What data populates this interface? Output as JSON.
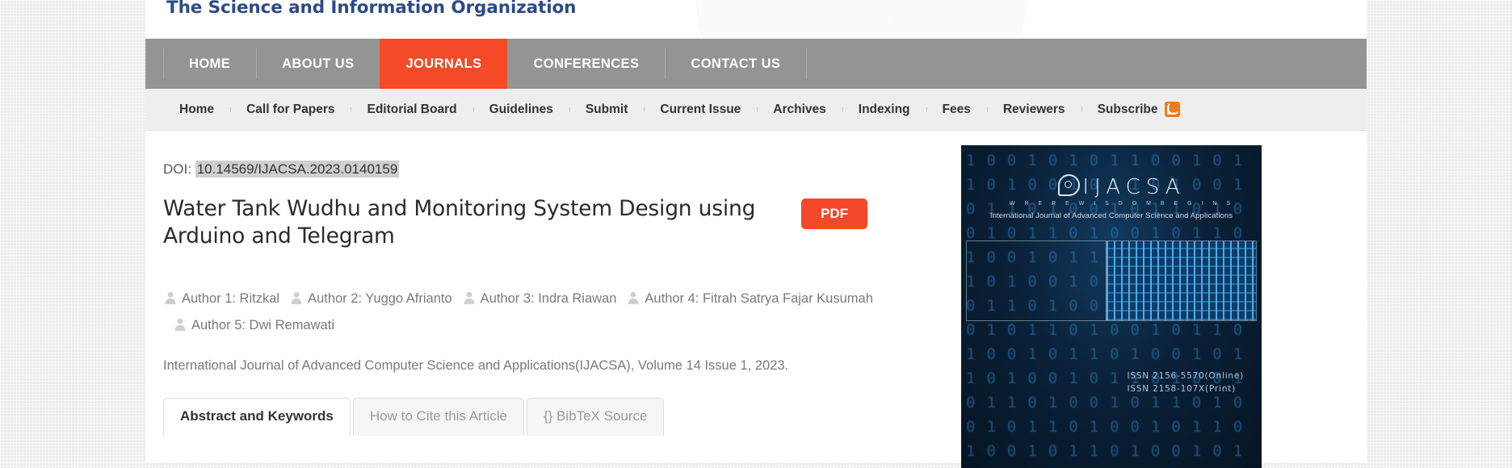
{
  "site": {
    "org_name": "The Science and Information Organization"
  },
  "main_nav": {
    "items": [
      {
        "label": "HOME",
        "active": false
      },
      {
        "label": "ABOUT US",
        "active": false
      },
      {
        "label": "JOURNALS",
        "active": true
      },
      {
        "label": "CONFERENCES",
        "active": false
      },
      {
        "label": "CONTACT US",
        "active": false
      }
    ],
    "active_color": "#f44a27",
    "bar_color": "#949494"
  },
  "sub_nav": {
    "items": [
      {
        "label": "Home"
      },
      {
        "label": "Call for Papers"
      },
      {
        "label": "Editorial Board"
      },
      {
        "label": "Guidelines"
      },
      {
        "label": "Submit"
      },
      {
        "label": "Current Issue"
      },
      {
        "label": "Archives"
      },
      {
        "label": "Indexing"
      },
      {
        "label": "Fees"
      },
      {
        "label": "Reviewers"
      },
      {
        "label": "Subscribe"
      }
    ],
    "rss_icon": "rss-icon",
    "rss_color": "#ee7b1e"
  },
  "article": {
    "doi_label": "DOI:",
    "doi_value": "10.14569/IJACSA.2023.0140159",
    "title": "Water Tank Wudhu and Monitoring System Design using Arduino and Telegram",
    "pdf_label": "PDF",
    "pdf_color": "#f4482a",
    "authors": [
      {
        "label": "Author 1: Ritzkal"
      },
      {
        "label": "Author 2: Yuggo Afrianto"
      },
      {
        "label": "Author 3: Indra Riawan"
      },
      {
        "label": "Author 4: Fitrah Satrya Fajar Kusumah"
      },
      {
        "label": "Author 5: Dwi Remawati"
      }
    ],
    "journal_line": "International Journal of Advanced Computer Science and Applications(IJACSA), Volume 14 Issue 1, 2023.",
    "tabs": [
      {
        "label": "Abstract and Keywords",
        "active": true
      },
      {
        "label": "How to Cite this Article",
        "active": false
      },
      {
        "label": "{} BibTeX Source",
        "active": false
      }
    ]
  },
  "cover": {
    "logo_text": "IJACSA",
    "logo_tagline": "W H E R E   W I S D O M   B E G I N S",
    "logo_subtitle": "International Journal of Advanced Computer Science and Applications",
    "issn_online": "ISSN 2156-5570(Online)",
    "issn_print": "ISSN 2158-107X(Print)"
  }
}
